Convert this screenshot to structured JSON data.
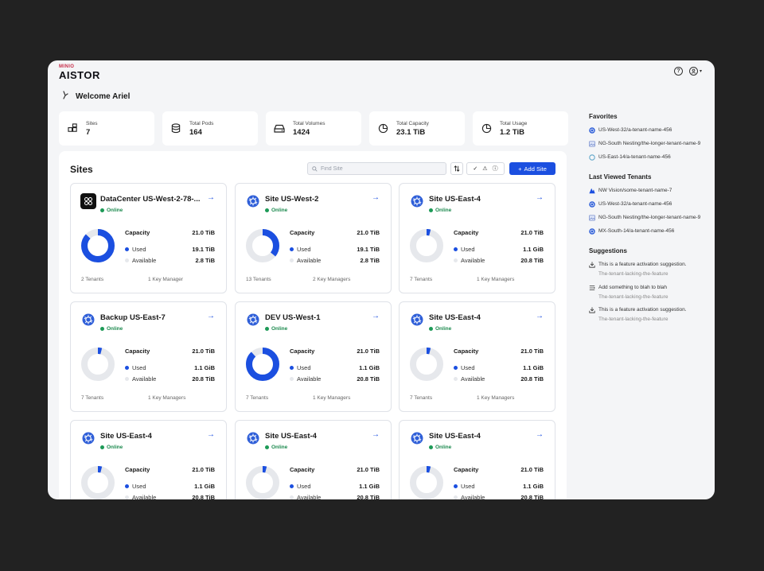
{
  "app": {
    "brand_small": "MINIO",
    "brand": "AISTOR"
  },
  "header": {
    "welcome": "Welcome Ariel"
  },
  "stats": [
    {
      "label": "Sites",
      "value": "7",
      "icon": "sites-icon"
    },
    {
      "label": "Total Pods",
      "value": "164",
      "icon": "database-icon"
    },
    {
      "label": "Total Volumes",
      "value": "1424",
      "icon": "drive-icon"
    },
    {
      "label": "Total Capacity",
      "value": "23.1 TiB",
      "icon": "pie-chart-icon"
    },
    {
      "label": "Total Usage",
      "value": "1.2 TiB",
      "icon": "pie-chart-icon"
    }
  ],
  "sites": {
    "title": "Sites",
    "search_placeholder": "Find Site",
    "add_label": "Add Site",
    "capacity_label": "Capacity",
    "used_label": "Used",
    "available_label": "Available",
    "colors": {
      "used": "#1b4fe0",
      "available": "#e6e8ec",
      "online": "#1d9a57"
    },
    "cards": [
      {
        "name": "DataCenter US-West-2-78-...",
        "status": "Online",
        "capacity": "21.0 TiB",
        "used": "19.1 TiB",
        "available": "2.8 TiB",
        "used_fraction": 0.87,
        "tenants": "2 Tenants",
        "keys": "1 Key Manager",
        "icon": "datacenter-icon"
      },
      {
        "name": "Site US-West-2",
        "status": "Online",
        "capacity": "21.0 TiB",
        "used": "19.1 TiB",
        "available": "2.8 TiB",
        "used_fraction": 0.36,
        "tenants": "13 Tenants",
        "keys": "2 Key Managers",
        "icon": "kubernetes-icon"
      },
      {
        "name": "Site US-East-4",
        "status": "Online",
        "capacity": "21.0 TiB",
        "used": "1.1 GiB",
        "available": "20.8 TiB",
        "used_fraction": 0.04,
        "tenants": "7 Tenants",
        "keys": "1 Key Managers",
        "icon": "kubernetes-icon"
      },
      {
        "name": "Backup US-East-7",
        "status": "Online",
        "capacity": "21.0 TiB",
        "used": "1.1 GiB",
        "available": "20.8 TiB",
        "used_fraction": 0.04,
        "tenants": "7 Tenants",
        "keys": "1 Key Managers",
        "icon": "kubernetes-icon"
      },
      {
        "name": "DEV US-West-1",
        "status": "Online",
        "capacity": "21.0 TiB",
        "used": "1.1 GiB",
        "available": "20.8 TiB",
        "used_fraction": 0.88,
        "tenants": "7 Tenants",
        "keys": "1 Key Managers",
        "icon": "kubernetes-icon"
      },
      {
        "name": "Site US-East-4",
        "status": "Online",
        "capacity": "21.0 TiB",
        "used": "1.1 GiB",
        "available": "20.8 TiB",
        "used_fraction": 0.04,
        "tenants": "7 Tenants",
        "keys": "1 Key Managers",
        "icon": "kubernetes-icon"
      },
      {
        "name": "Site US-East-4",
        "status": "Online",
        "capacity": "21.0 TiB",
        "used": "1.1 GiB",
        "available": "20.8 TiB",
        "used_fraction": 0.04,
        "tenants": "",
        "keys": "",
        "icon": "kubernetes-icon"
      },
      {
        "name": "Site US-East-4",
        "status": "Online",
        "capacity": "21.0 TiB",
        "used": "1.1 GiB",
        "available": "20.8 TiB",
        "used_fraction": 0.04,
        "tenants": "",
        "keys": "",
        "icon": "kubernetes-icon"
      },
      {
        "name": "Site US-East-4",
        "status": "Online",
        "capacity": "21.0 TiB",
        "used": "1.1 GiB",
        "available": "20.8 TiB",
        "used_fraction": 0.04,
        "tenants": "",
        "keys": "",
        "icon": "kubernetes-icon"
      }
    ]
  },
  "favorites": {
    "title": "Favorites",
    "items": [
      {
        "label": "US-West-32/a-tenant-name-456",
        "icon": "kubernetes-icon"
      },
      {
        "label": "NG-South Nesting/the-longer-tenant-name-9",
        "icon": "image-icon"
      },
      {
        "label": "US-East-14/a-tenant-name-456",
        "icon": "ring-icon"
      }
    ]
  },
  "last_viewed": {
    "title": "Last Viewed Tenants",
    "items": [
      {
        "label": "NW Vision/some-tenant-name-7",
        "icon": "vision-icon"
      },
      {
        "label": "US-West-32/a-tenant-name-456",
        "icon": "kubernetes-icon"
      },
      {
        "label": "NG-South Nesting/the-longer-tenant-name-9",
        "icon": "image-icon"
      },
      {
        "label": "MX-South-14/a-tenant-name-456",
        "icon": "kubernetes-icon"
      }
    ]
  },
  "suggestions": {
    "title": "Suggestions",
    "items": [
      {
        "label": "This is a feature activation suggestion.",
        "sub": "The-tenant-lacking-the-feature",
        "icon": "download-icon"
      },
      {
        "label": "Add something to blah to blah",
        "sub": "The-tenant-lacking-the-feature",
        "icon": "list-icon"
      },
      {
        "label": "This is a feature activation suggestion.",
        "sub": "The-tenant-lacking-the-feature",
        "icon": "download-icon"
      }
    ]
  }
}
